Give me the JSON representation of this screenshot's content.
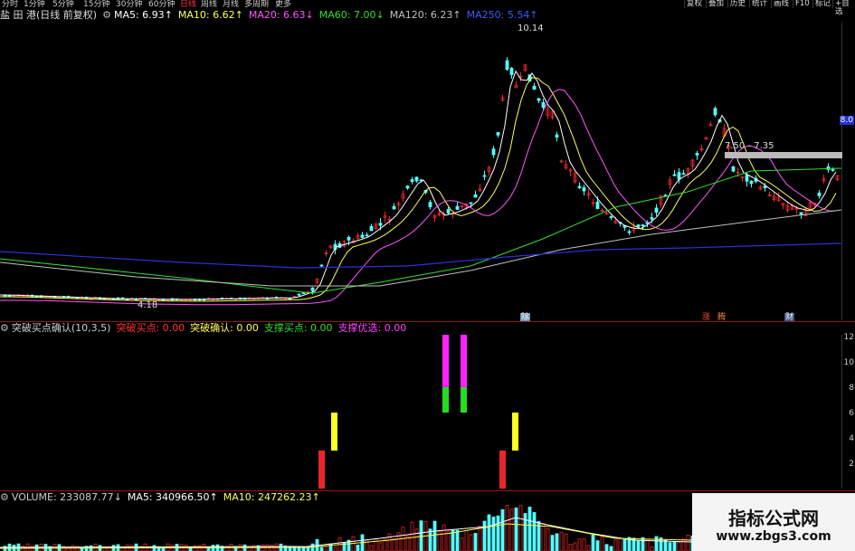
{
  "periods": [
    "分时",
    "1分钟",
    "5分钟",
    "15分钟",
    "30分钟",
    "60分钟",
    "日线",
    "周线",
    "月线",
    "多周期",
    "更多"
  ],
  "active_period": "日线",
  "toolbar": [
    "复权",
    "叠加",
    "历史",
    "统计",
    "画线",
    "F10",
    "标记",
    "+自选"
  ],
  "main_info": {
    "title": "盐 田 港(日线 前复权)",
    "ma5": "MA5: 6.93↑",
    "ma10": "MA10: 6.62↑",
    "ma20": "MA20: 6.63↓",
    "ma60": "MA60: 7.00↓",
    "ma120": "MA120: 6.23↑",
    "ma250": "MA250: 5.54↑"
  },
  "annotations": {
    "high": "10.14",
    "low": "4.18",
    "zone": "7.50 - 7.35"
  },
  "event_tags": [
    "除",
    "涨",
    "腾",
    "财"
  ],
  "right_axis_badge": "8.0",
  "indicator_info": {
    "name": "突破买点确认(10,3,5)",
    "v1": "突破买点: 0.00",
    "v2": "突破确认: 0.00",
    "v3": "支撑买点: 0.00",
    "v4": "支撑优选: 0.00"
  },
  "indicator_axis": [
    "12",
    "10",
    "8",
    "6",
    "4",
    "2"
  ],
  "volume_info": {
    "vol": "VOLUME: 233087.77↓",
    "ma5": "MA5: 340966.50↑",
    "ma10": "MA10: 247262.23↑"
  },
  "watermark": {
    "cn": "指标公式网",
    "url": "www.zbgs3.com"
  },
  "colors": {
    "up": "#e8262a",
    "down": "#54ffff",
    "ma5": "#ffffff",
    "ma10": "#ffff55",
    "ma20": "#ff55ff",
    "ma60": "#33dd33",
    "ma120": "#c0c0c0",
    "ma250": "#2f2fd8"
  }
}
